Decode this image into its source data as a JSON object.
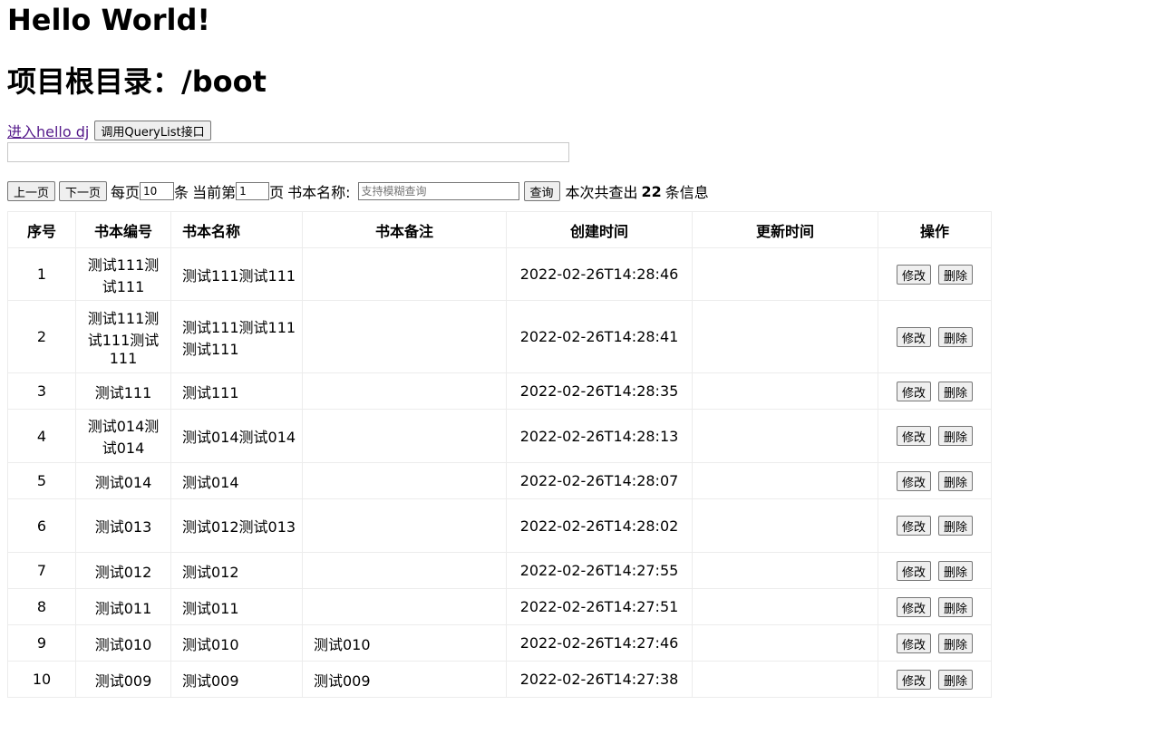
{
  "heading": {
    "hello": "Hello World!",
    "root_label": "项目根目录：/boot"
  },
  "links": {
    "hello_dj": "进入hello dj",
    "query_btn": "调用QueryList接口"
  },
  "toolbar": {
    "prev_label": "上一页",
    "next_label": "下一页",
    "per_page_prefix": "每页",
    "per_page_value": "10",
    "per_page_suffix": "条",
    "current_prefix": "当前第",
    "current_value": "1",
    "current_suffix": "页",
    "name_label": "书本名称:",
    "search_placeholder": "支持模糊查询",
    "search_btn": "查询",
    "result_prefix": "本次共查出",
    "result_count": "22",
    "result_suffix": "条信息"
  },
  "table": {
    "headers": [
      "序号",
      "书本编号",
      "书本名称",
      "书本备注",
      "创建时间",
      "更新时间",
      "操作"
    ],
    "edit_label": "修改",
    "delete_label": "删除",
    "rows": [
      {
        "no": "1",
        "code": "测试111测试111",
        "name": "测试111测试111",
        "remark": "",
        "created": "2022-02-26T14:28:46",
        "updated": ""
      },
      {
        "no": "2",
        "code": "测试111测试111测试111",
        "name": "测试111测试111测试111",
        "remark": "",
        "created": "2022-02-26T14:28:41",
        "updated": ""
      },
      {
        "no": "3",
        "code": "测试111",
        "name": "测试111",
        "remark": "",
        "created": "2022-02-26T14:28:35",
        "updated": ""
      },
      {
        "no": "4",
        "code": "测试014测试014",
        "name": "测试014测试014",
        "remark": "",
        "created": "2022-02-26T14:28:13",
        "updated": ""
      },
      {
        "no": "5",
        "code": "测试014",
        "name": "测试014",
        "remark": "",
        "created": "2022-02-26T14:28:07",
        "updated": ""
      },
      {
        "no": "6",
        "code": "测试013",
        "name": "测试012测试013",
        "remark": "",
        "created": "2022-02-26T14:28:02",
        "updated": ""
      },
      {
        "no": "7",
        "code": "测试012",
        "name": "测试012",
        "remark": "",
        "created": "2022-02-26T14:27:55",
        "updated": ""
      },
      {
        "no": "8",
        "code": "测试011",
        "name": "测试011",
        "remark": "",
        "created": "2022-02-26T14:27:51",
        "updated": ""
      },
      {
        "no": "9",
        "code": "测试010",
        "name": "测试010",
        "remark": "测试010",
        "created": "2022-02-26T14:27:46",
        "updated": ""
      },
      {
        "no": "10",
        "code": "测试009",
        "name": "测试009",
        "remark": "测试009",
        "created": "2022-02-26T14:27:38",
        "updated": ""
      }
    ]
  }
}
